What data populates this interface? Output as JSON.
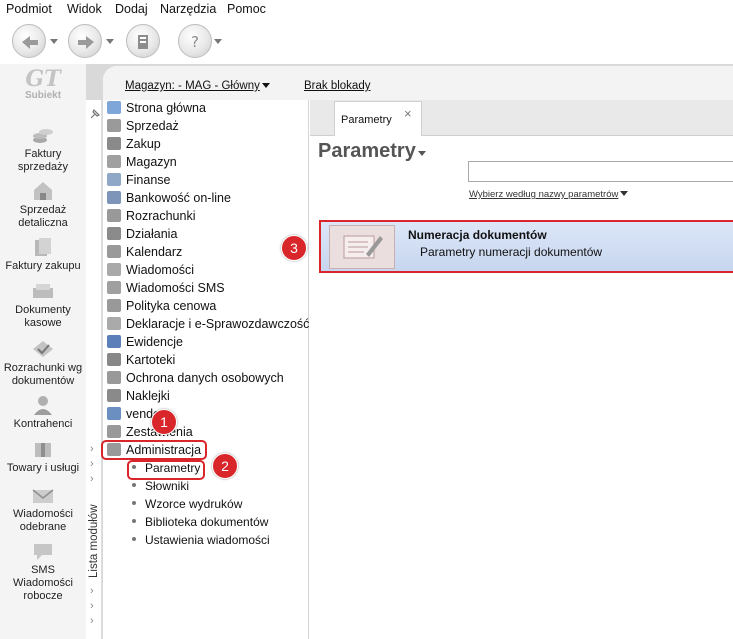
{
  "menu": [
    "Podmiot",
    "Widok",
    "Dodaj",
    "Narzędzia",
    "Pomoc"
  ],
  "toolbar_icons": [
    "arrow-back-icon",
    "arrow-forward-icon",
    "tools-icon",
    "help-icon"
  ],
  "logo": {
    "text": "GT",
    "sub": "Subiekt"
  },
  "appbar": [
    {
      "label": "Faktury sprzedaży",
      "icon": "coins-icon"
    },
    {
      "label": "Sprzedaż detaliczna",
      "icon": "store-icon"
    },
    {
      "label": "Faktury zakupu",
      "icon": "invoices-icon"
    },
    {
      "label": "Dokumenty kasowe",
      "icon": "cash-icon"
    },
    {
      "label": "Rozrachunki wg dokumentów",
      "icon": "settlement-icon"
    },
    {
      "label": "Kontrahenci",
      "icon": "person-icon"
    },
    {
      "label": "Towary i usługi",
      "icon": "package-icon"
    },
    {
      "label": "Wiadomości odebrane",
      "icon": "mail-in-icon"
    },
    {
      "label": "SMS Wiadomości robocze",
      "icon": "sms-icon"
    }
  ],
  "infobar": {
    "warehouse": "Magazyn: - MAG - Główny",
    "lock": "Brak blokady"
  },
  "module_strip": {
    "label": "Lista modułów"
  },
  "tree": [
    "Strona główna",
    "Sprzedaż",
    "Zakup",
    "Magazyn",
    "Finanse",
    "Bankowość on-line",
    "Rozrachunki",
    "Działania",
    "Kalendarz",
    "Wiadomości",
    "Wiadomości SMS",
    "Polityka cenowa",
    "Deklaracje i e-Sprawozdawczość",
    "Ewidencje",
    "Kartoteki",
    "Ochrona danych osobowych",
    "Naklejki",
    "vendero",
    "Zestawienia",
    "Administracja"
  ],
  "tree_sub": [
    "Parametry",
    "Słowniki",
    "Wzorce wydruków",
    "Biblioteka dokumentów",
    "Ustawienia wiadomości"
  ],
  "tab": {
    "label": "Parametry",
    "close": "×"
  },
  "page_title": "Parametry",
  "search": {
    "value": "",
    "hint": "Wybierz według nazwy parametrów"
  },
  "result": {
    "title": "Numeracja dokumentów",
    "desc": "Parametry numeracji dokumentów"
  },
  "markers": [
    "1",
    "2",
    "3"
  ],
  "colors": {
    "accent_red": "#d9262b",
    "highlight_blue": "#c7d6ef"
  }
}
